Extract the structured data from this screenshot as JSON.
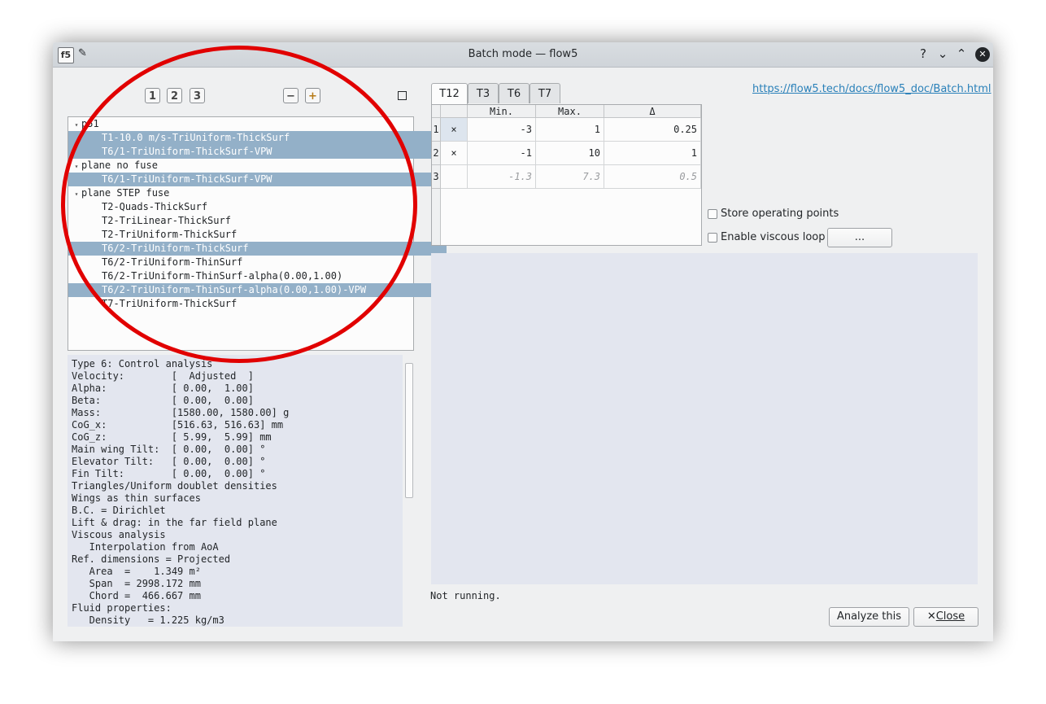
{
  "window": {
    "title": "Batch mode — flow5",
    "help": "?",
    "minimize": "⌄",
    "maximize": "⌃",
    "close": "✕"
  },
  "toolbar": {
    "btn1": "1",
    "btn2": "2",
    "btn3": "3",
    "minus": "−",
    "plus": "+"
  },
  "tree": [
    {
      "text": "p51",
      "level": 0,
      "selected": false,
      "expandable": true
    },
    {
      "text": "T1-10.0 m/s-TriUniform-ThickSurf",
      "level": 1,
      "selected": true
    },
    {
      "text": "T6/1-TriUniform-ThickSurf-VPW",
      "level": 1,
      "selected": true
    },
    {
      "text": "plane no fuse",
      "level": 0,
      "selected": false,
      "expandable": true
    },
    {
      "text": "T6/1-TriUniform-ThickSurf-VPW",
      "level": 1,
      "selected": true
    },
    {
      "text": "plane STEP fuse",
      "level": 0,
      "selected": false,
      "expandable": true
    },
    {
      "text": "T2-Quads-ThickSurf",
      "level": 1,
      "selected": false
    },
    {
      "text": "T2-TriLinear-ThickSurf",
      "level": 1,
      "selected": false
    },
    {
      "text": "T2-TriUniform-ThickSurf",
      "level": 1,
      "selected": false
    },
    {
      "text": "T6/2-TriUniform-ThickSurf",
      "level": 1,
      "selected": true
    },
    {
      "text": "T6/2-TriUniform-ThinSurf",
      "level": 1,
      "selected": false
    },
    {
      "text": "T6/2-TriUniform-ThinSurf-alpha(0.00,1.00)",
      "level": 1,
      "selected": false
    },
    {
      "text": "T6/2-TriUniform-ThinSurf-alpha(0.00,1.00)-VPW",
      "level": 1,
      "selected": true
    },
    {
      "text": "T7-TriUniform-ThickSurf",
      "level": 1,
      "selected": false
    }
  ],
  "details": [
    "Type 6: Control analysis",
    "Velocity:        [  Adjusted  ]",
    "Alpha:           [ 0.00,  1.00]",
    "Beta:            [ 0.00,  0.00]",
    "Mass:            [1580.00, 1580.00] g",
    "CoG_x:           [516.63, 516.63] mm",
    "CoG_z:           [ 5.99,  5.99] mm",
    "Main wing Tilt:  [ 0.00,  0.00] °",
    "Elevator Tilt:   [ 0.00,  0.00] °",
    "Fin Tilt:        [ 0.00,  0.00] °",
    "Triangles/Uniform doublet densities",
    "Wings as thin surfaces",
    "B.C. = Dirichlet",
    "Lift & drag: in the far field plane",
    "Viscous analysis",
    "   Interpolation from AoA",
    "Ref. dimensions = Projected",
    "   Area  =    1.349 m²",
    "   Span  = 2998.172 mm",
    "   Chord =  466.667 mm",
    "Fluid properties:",
    "   Density   = 1.225 kg/m3"
  ],
  "tabs": [
    "T12",
    "T3",
    "T6",
    "T7"
  ],
  "active_tab": "T12",
  "grid": {
    "headers": [
      "Min.",
      "Max.",
      "Δ"
    ],
    "rows": [
      {
        "num": "1",
        "mark": "×",
        "min": "-3",
        "max": "1",
        "delta": "0.25"
      },
      {
        "num": "2",
        "mark": "×",
        "min": "-1",
        "max": "10",
        "delta": "1"
      },
      {
        "num": "3",
        "mark": "",
        "min": "-1.3",
        "max": "7.3",
        "delta": "0.5"
      }
    ]
  },
  "doc_link": "https://flow5.tech/docs/flow5_doc/Batch.html",
  "options": {
    "store_op": "Store operating points",
    "viscous_loop": "Enable viscous loop",
    "ellipsis": "..."
  },
  "status": "Not running.",
  "buttons": {
    "analyze": "Analyze this",
    "close": "Close"
  }
}
